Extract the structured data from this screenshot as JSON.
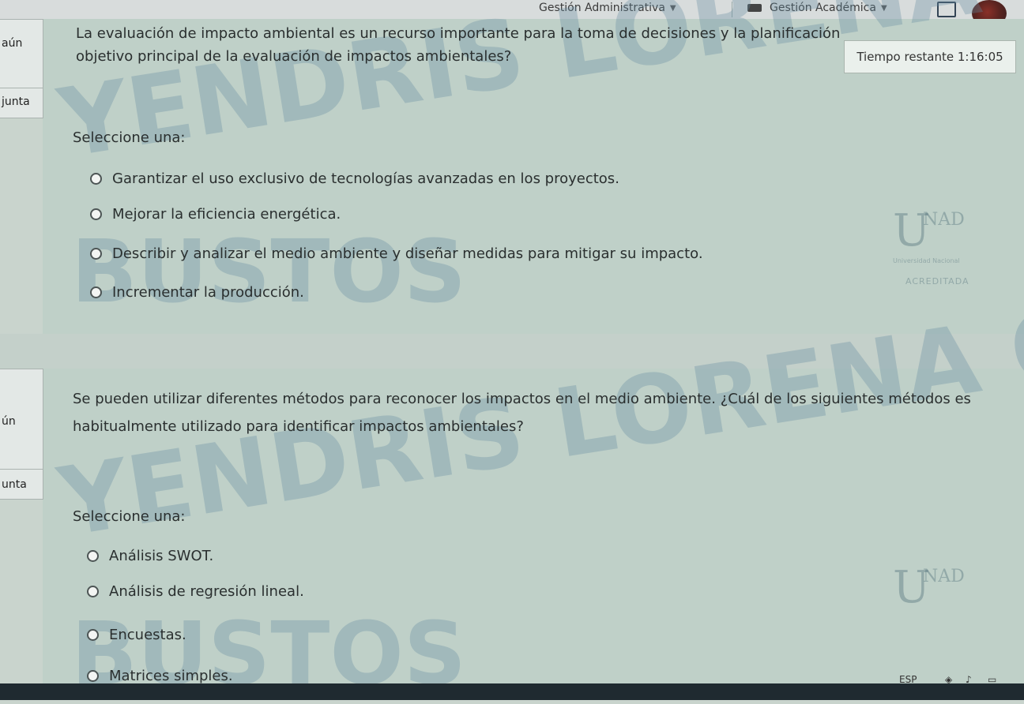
{
  "topbar": {
    "menu1_label": "Gestión Administrativa",
    "menu2_label": "Gestión Académica"
  },
  "sidebar": {
    "q1_state": "aún",
    "q1_label": "junta",
    "q2_state": "ún",
    "q2_label": "unta"
  },
  "timer": {
    "text": "Tiempo restante 1:16:05"
  },
  "question1": {
    "line1": "La evaluación de impacto ambiental es un recurso importante para la toma de decisiones y la planificación",
    "line2": "objetivo principal de la evaluación de impactos ambientales?",
    "select_label": "Seleccione una:",
    "options": [
      "Garantizar el uso exclusivo de tecnologías avanzadas en los proyectos.",
      "Mejorar la eficiencia energética.",
      "Describir y analizar el medio ambiente y diseñar medidas para mitigar su impacto.",
      "Incrementar la producción."
    ]
  },
  "question2": {
    "line1": "Se pueden utilizar diferentes métodos para reconocer los impactos en el medio ambiente. ¿Cuál de los siguientes métodos es",
    "line2": "habitualmente utilizado para identificar impactos ambientales?",
    "select_label": "Seleccione una:",
    "options": [
      "Análisis SWOT.",
      "Análisis de regresión lineal.",
      "Encuestas.",
      "Matrices simples."
    ]
  },
  "watermark": {
    "line_a": "YENDRIS LORENA QUINTERO",
    "line_b": "BUSTOS"
  },
  "logo": {
    "u": "U",
    "nad": "NAD",
    "sub": "Universidad Nacional",
    "acc": "ACREDITADA"
  },
  "taskbar": {
    "lang": "ESP"
  },
  "colors": {
    "panel": "#bfd0c8",
    "background": "#c9d4cd",
    "watermark": "#648ca0"
  }
}
